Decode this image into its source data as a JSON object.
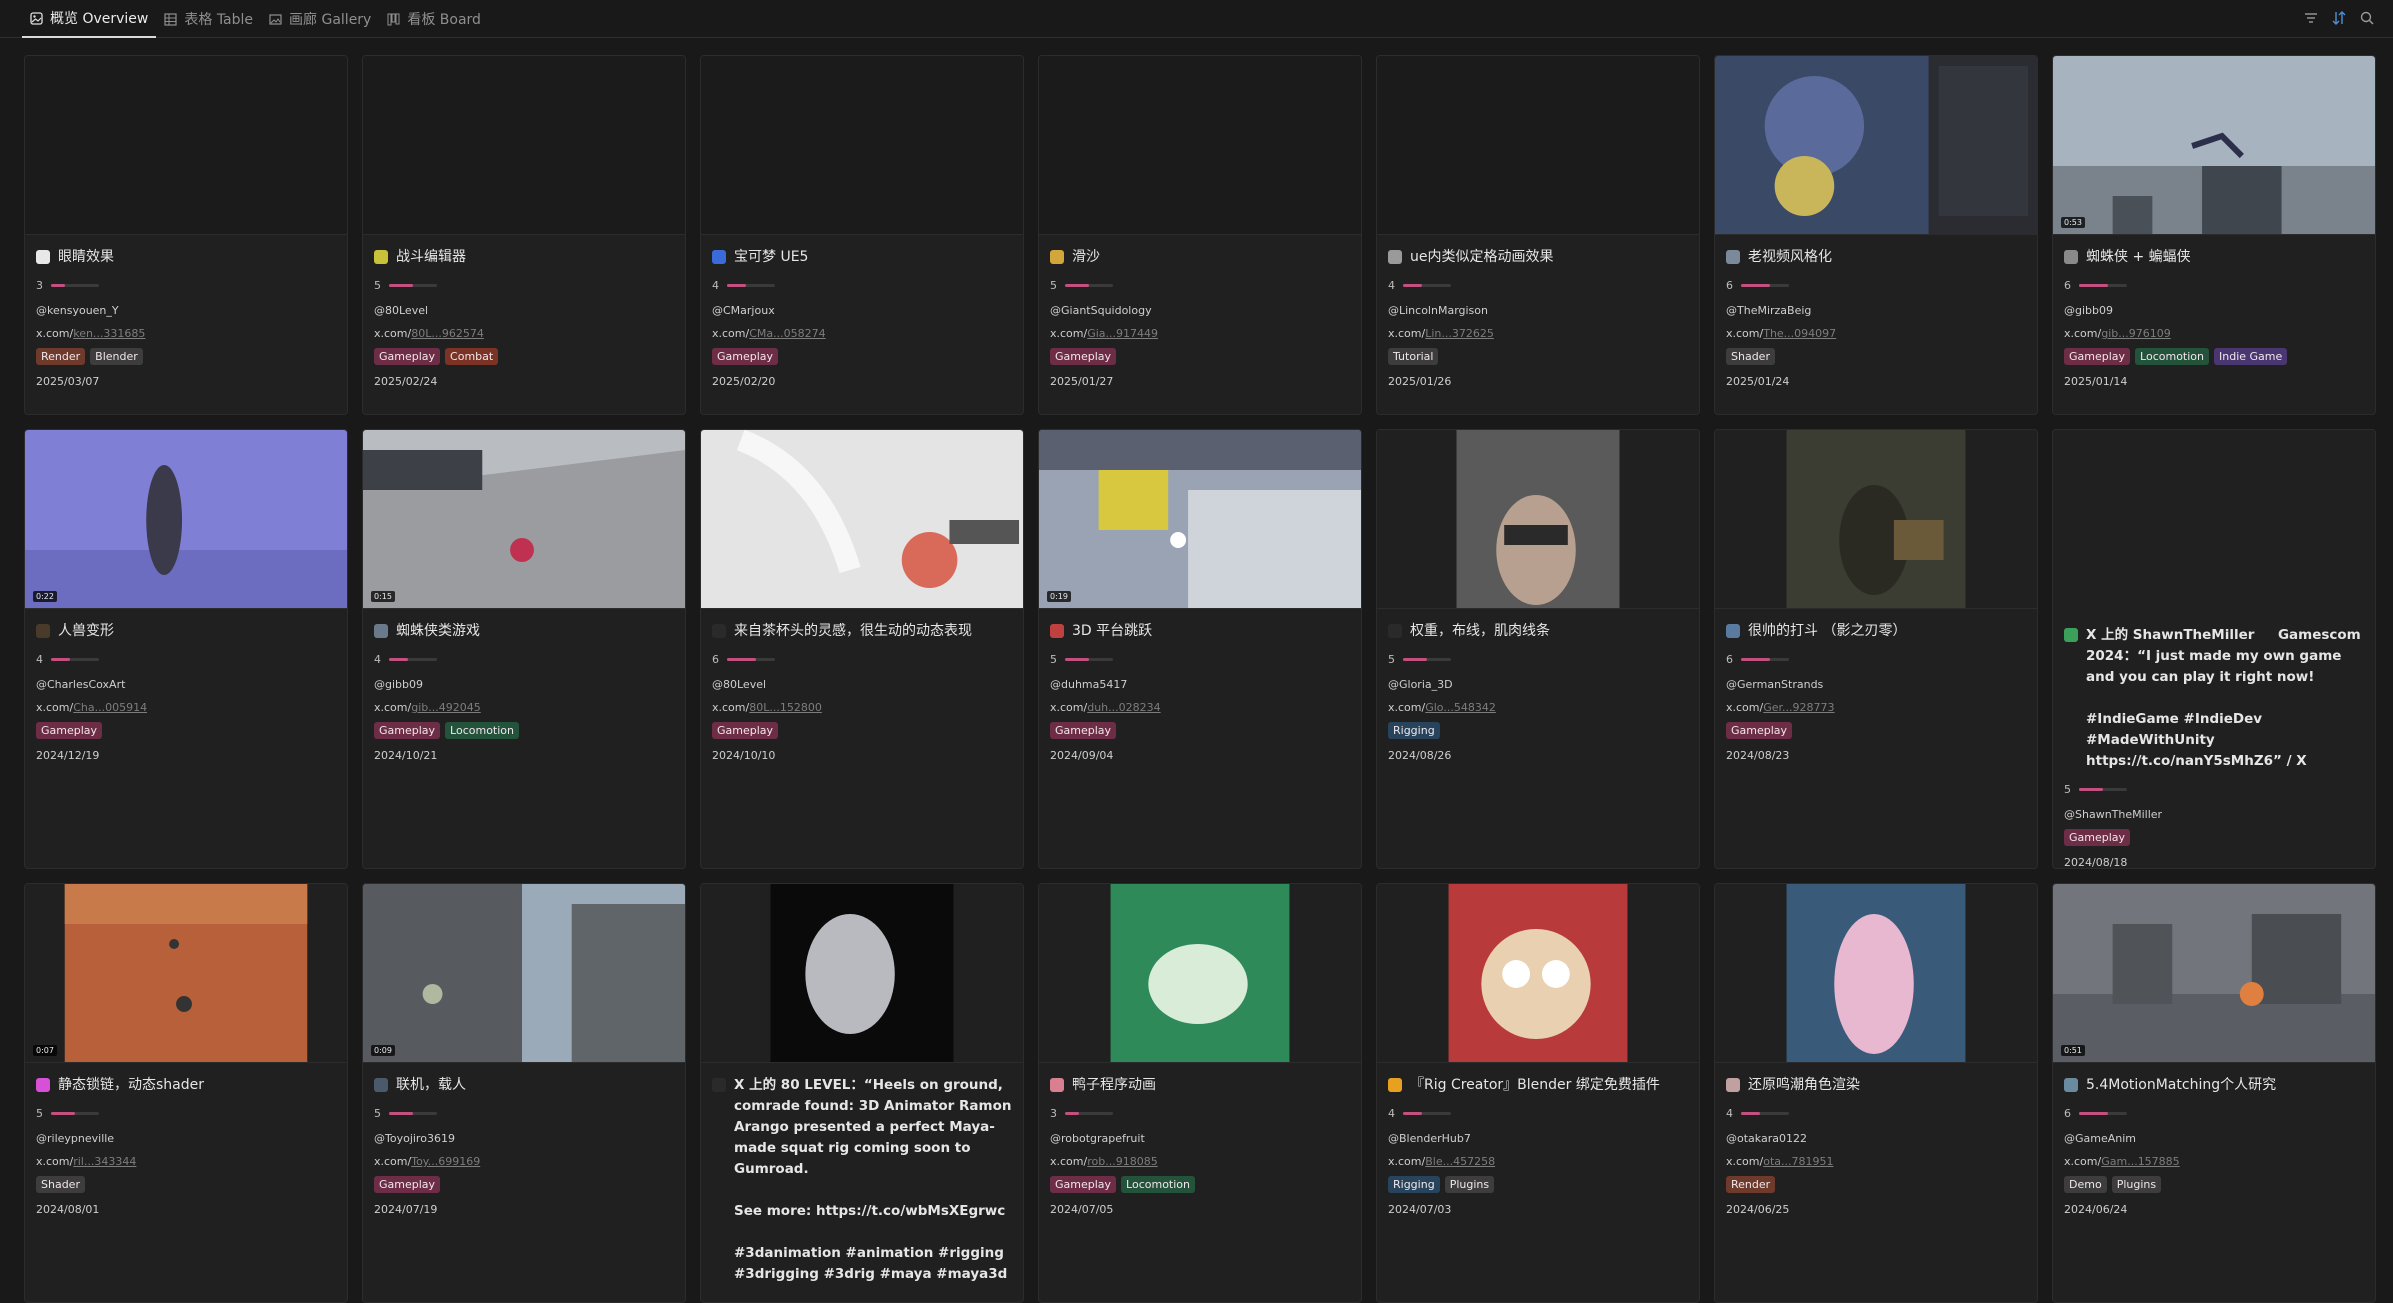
{
  "tabs": [
    {
      "label": "概览 Overview",
      "icon": "gallery-icon",
      "active": true
    },
    {
      "label": "表格 Table",
      "icon": "table-icon",
      "active": false
    },
    {
      "label": "画廊 Gallery",
      "icon": "image-icon",
      "active": false
    },
    {
      "label": "看板 Board",
      "icon": "board-icon",
      "active": false
    }
  ],
  "tools": [
    "filter-icon",
    "sort-icon",
    "search-icon"
  ],
  "cards": [
    {
      "title": "眼睛效果",
      "rating": "3",
      "author": "@kensyouen_Y",
      "link_domain": "x.com/",
      "link_rest": "ken...331685",
      "tags": [
        "Render",
        "Blender"
      ],
      "date": "2025/03/07"
    },
    {
      "title": "战斗编辑器",
      "rating": "5",
      "author": "@80Level",
      "link_domain": "x.com/",
      "link_rest": "80L...962574",
      "tags": [
        "Gameplay",
        "Combat"
      ],
      "date": "2025/02/24"
    },
    {
      "title": "宝可梦 UE5",
      "rating": "4",
      "author": "@CMarjoux",
      "link_domain": "x.com/",
      "link_rest": "CMa...058274",
      "tags": [
        "Gameplay"
      ],
      "date": "2025/02/20"
    },
    {
      "title": "滑沙",
      "rating": "5",
      "author": "@GiantSquidology",
      "link_domain": "x.com/",
      "link_rest": "Gia...917449",
      "tags": [
        "Gameplay"
      ],
      "date": "2025/01/27"
    },
    {
      "title": "ue内类似定格动画效果",
      "rating": "4",
      "author": "@LincolnMargison",
      "link_domain": "x.com/",
      "link_rest": "Lin...372625",
      "tags": [
        "Tutorial"
      ],
      "date": "2025/01/26"
    },
    {
      "title": "老视频风格化",
      "rating": "6",
      "author": "@TheMirzaBeig",
      "link_domain": "x.com/",
      "link_rest": "The...094097",
      "tags": [
        "Shader"
      ],
      "date": "2025/01/24",
      "duration": ""
    },
    {
      "title": "蜘蛛侠 + 蝙蝠侠",
      "rating": "6",
      "author": "@gibb09",
      "link_domain": "x.com/",
      "link_rest": "gib...976109",
      "tags": [
        "Gameplay",
        "Locomotion",
        "Indie Game"
      ],
      "date": "2025/01/14",
      "duration": "0:53"
    },
    {
      "title": "人兽变形",
      "rating": "4",
      "author": "@CharlesCoxArt",
      "link_domain": "x.com/",
      "link_rest": "Cha...005914",
      "tags": [
        "Gameplay"
      ],
      "date": "2024/12/19",
      "duration": "0:22"
    },
    {
      "title": "蜘蛛侠类游戏",
      "rating": "4",
      "author": "@gibb09",
      "link_domain": "x.com/",
      "link_rest": "gib...492045",
      "tags": [
        "Gameplay",
        "Locomotion"
      ],
      "date": "2024/10/21",
      "duration": "0:15"
    },
    {
      "title": "来自茶杯头的灵感，很生动的动态表现",
      "rating": "6",
      "author": "@80Level",
      "link_domain": "x.com/",
      "link_rest": "80L...152800",
      "tags": [
        "Gameplay"
      ],
      "date": "2024/10/10"
    },
    {
      "title": "3D 平台跳跃",
      "rating": "5",
      "author": "@duhma5417",
      "link_domain": "x.com/",
      "link_rest": "duh...028234",
      "tags": [
        "Gameplay"
      ],
      "date": "2024/09/04",
      "duration": "0:19"
    },
    {
      "title": "权重，布线，肌肉线条",
      "rating": "5",
      "author": "@Gloria_3D",
      "link_domain": "x.com/",
      "link_rest": "Glo...548342",
      "tags": [
        "Rigging"
      ],
      "date": "2024/08/26"
    },
    {
      "title": "很帅的打斗 （影之刃零）",
      "rating": "6",
      "author": "@GermanStrands",
      "link_domain": "x.com/",
      "link_rest": "Ger...928773",
      "tags": [
        "Gameplay"
      ],
      "date": "2024/08/23"
    },
    {
      "title": "X 上的 ShawnTheMiller     Gamescom 2024：“I just made my own game and you can play it right now!\n\n#IndieGame #IndieDev #MadeWithUnity https://t.co/nanY5sMhZ6” / X",
      "rating": "5",
      "author": "@ShawnTheMiller",
      "link_domain": "",
      "link_rest": "",
      "tags": [
        "Gameplay"
      ],
      "date": "2024/08/18",
      "long": true
    },
    {
      "title": "静态锁链，动态shader",
      "rating": "5",
      "author": "@rileypneville",
      "link_domain": "x.com/",
      "link_rest": "ril...343344",
      "tags": [
        "Shader"
      ],
      "date": "2024/08/01",
      "duration": "0:07"
    },
    {
      "title": "联机，载人",
      "rating": "5",
      "author": "@Toyojiro3619",
      "link_domain": "x.com/",
      "link_rest": "Toy...699169",
      "tags": [
        "Gameplay"
      ],
      "date": "2024/07/19",
      "duration": "0:09"
    },
    {
      "title": "X 上的 80 LEVEL：“Heels on ground, comrade found: 3D Animator Ramon Arango presented a perfect Maya-made squat rig coming soon to Gumroad.\n\nSee more: https://t.co/wbMsXEgrwc\n\n#3danimation #animation #rigging #3drigging #3drig #maya #maya3d",
      "rating": "",
      "author": "",
      "link_domain": "",
      "link_rest": "",
      "tags": [],
      "date": "",
      "long": true
    },
    {
      "title": "鸭子程序动画",
      "rating": "3",
      "author": "@robotgrapefruit",
      "link_domain": "x.com/",
      "link_rest": "rob...918085",
      "tags": [
        "Gameplay",
        "Locomotion"
      ],
      "date": "2024/07/05"
    },
    {
      "title": "『Rig Creator』Blender 绑定免费插件",
      "rating": "4",
      "author": "@BlenderHub7",
      "link_domain": "x.com/",
      "link_rest": "Ble...457258",
      "tags": [
        "Rigging",
        "Plugins"
      ],
      "date": "2024/07/03"
    },
    {
      "title": "还原鸣潮角色渲染",
      "rating": "4",
      "author": "@otakara0122",
      "link_domain": "x.com/",
      "link_rest": "ota...781951",
      "tags": [
        "Render"
      ],
      "date": "2024/06/25"
    },
    {
      "title": "5.4MotionMatching个人研究",
      "rating": "6",
      "author": "@GameAnim",
      "link_domain": "x.com/",
      "link_rest": "Gam...157885",
      "tags": [
        "Demo",
        "Plugins"
      ],
      "date": "2024/06/24",
      "duration": "0:51"
    }
  ],
  "colors": {
    "accent": "#c4507f",
    "background": "#191919",
    "card": "#202020"
  }
}
